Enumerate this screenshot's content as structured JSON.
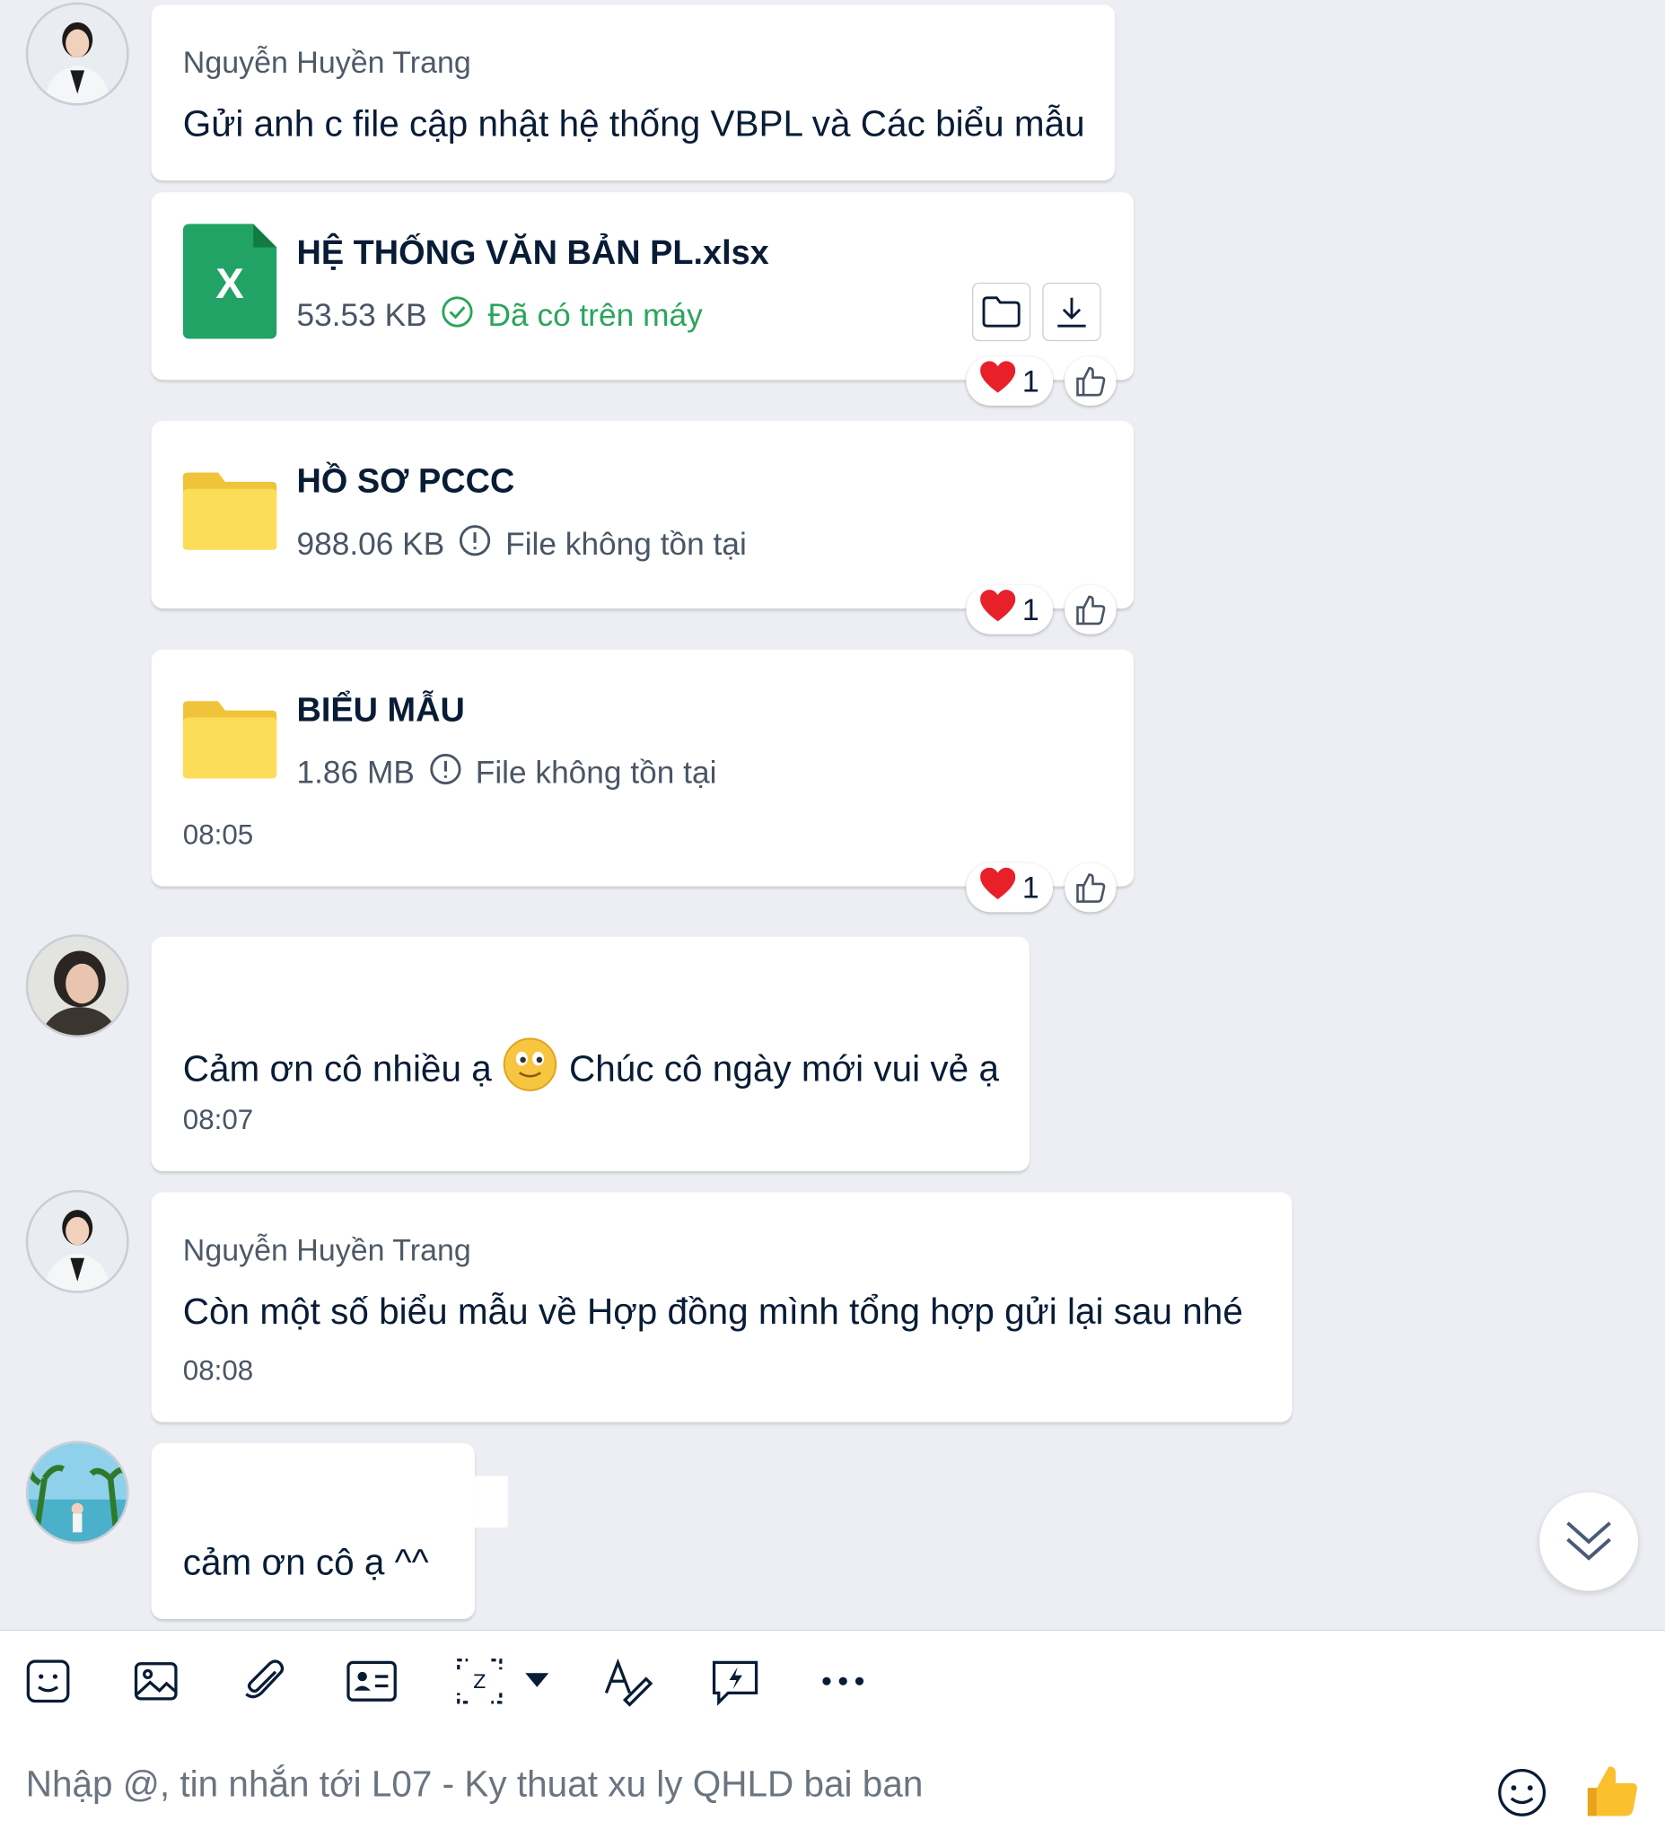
{
  "messages": [
    {
      "sender": "Nguyễn Huyền Trang",
      "text": "Gửi anh c file cập nhật hệ thống VBPL và Các biểu mẫu"
    }
  ],
  "files": [
    {
      "name": "HỆ THỐNG VĂN BẢN PL.xlsx",
      "size": "53.53 KB",
      "status": "Đã có trên máy",
      "type_icon": "excel-icon",
      "icon_letter": "X",
      "reaction_count": "1"
    },
    {
      "name": "HỒ SƠ PCCC",
      "size": "988.06 KB",
      "status": "File không tồn tại",
      "type_icon": "folder-icon",
      "reaction_count": "1"
    },
    {
      "name": "BIỂU MẪU",
      "size": "1.86 MB",
      "status": "File không tồn tại",
      "type_icon": "folder-icon",
      "time": "08:05",
      "reaction_count": "1"
    }
  ],
  "reply1": {
    "text_part1": "Cảm ơn cô nhiều ạ",
    "emoji": "smiley",
    "text_part2": "Chúc cô ngày mới vui vẻ ạ",
    "time": "08:07"
  },
  "message2": {
    "sender": "Nguyễn Huyền Trang",
    "text": "Còn một số biểu mẫu về Hợp đồng mình tổng hợp gửi lại sau nhé",
    "time": "08:08"
  },
  "reply2": {
    "text": "cảm ơn cô ạ ^^"
  },
  "toolbar": {
    "icons": [
      "sticker-icon",
      "image-icon",
      "attachment-icon",
      "contact-card-icon",
      "screenshot-icon",
      "dropdown-caret-icon",
      "text-format-icon",
      "quick-message-icon",
      "more-icon"
    ]
  },
  "composer": {
    "placeholder": "Nhập @, tin nhắn tới L07 - Ky thuat xu ly QHLD bai ban"
  },
  "colors": {
    "background": "#eceef3",
    "success": "#2aa55b",
    "excel": "#21a366",
    "folder": "#f8d649",
    "heart": "#e8202a",
    "accent": "#0068ff"
  }
}
